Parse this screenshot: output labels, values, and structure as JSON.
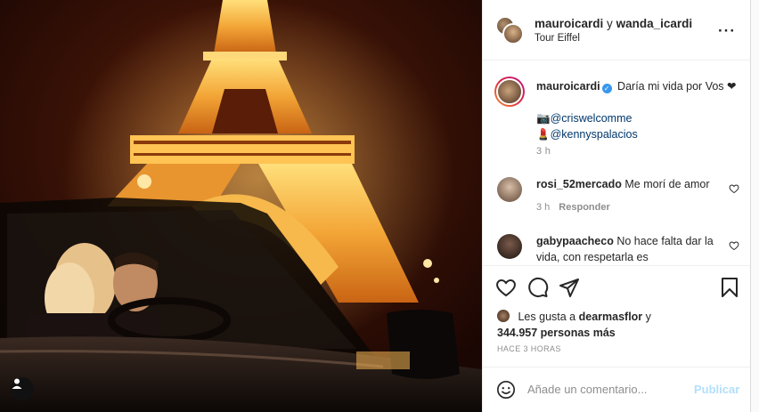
{
  "header": {
    "user_1": "mauroicardi",
    "separator": "y",
    "user_2": "wanda_icardi",
    "location": "Tour Eiffel",
    "more_icon": "more-horizontal-icon"
  },
  "caption": {
    "username": "mauroicardi",
    "verified_icon": "verified-badge-icon",
    "text": "Daría mi vida por Vos ❤",
    "credits": [
      {
        "emoji": "📷",
        "mention": "@criswelcomme"
      },
      {
        "emoji": "💄",
        "mention": "@kennyspalacios"
      }
    ],
    "time": "3 h"
  },
  "comments": [
    {
      "username": "rosi_52mercado",
      "text": "Me morí de amor",
      "time": "3 h",
      "reply": "Responder"
    },
    {
      "username": "gabypaacheco",
      "text": "No hace falta dar la vida, con respetarla es"
    }
  ],
  "actions": {
    "like_icon": "heart-icon",
    "comment_icon": "comment-bubble-icon",
    "share_icon": "paper-plane-icon",
    "save_icon": "bookmark-icon"
  },
  "likes": {
    "prefix": "Les gusta a",
    "user": "dearmasflor",
    "and": "y",
    "count": "344.957 personas más"
  },
  "posted": "HACE 3 HORAS",
  "add_comment": {
    "placeholder": "Añade un comentario...",
    "publish": "Publicar",
    "emoji_icon": "emoji-smile-icon"
  },
  "photo": {
    "tag_icon": "user-tag-icon"
  },
  "colors": {
    "link": "#00376b",
    "verified": "#3897f0",
    "muted": "#8e8e8e",
    "publish_disabled": "#b2dffc"
  }
}
